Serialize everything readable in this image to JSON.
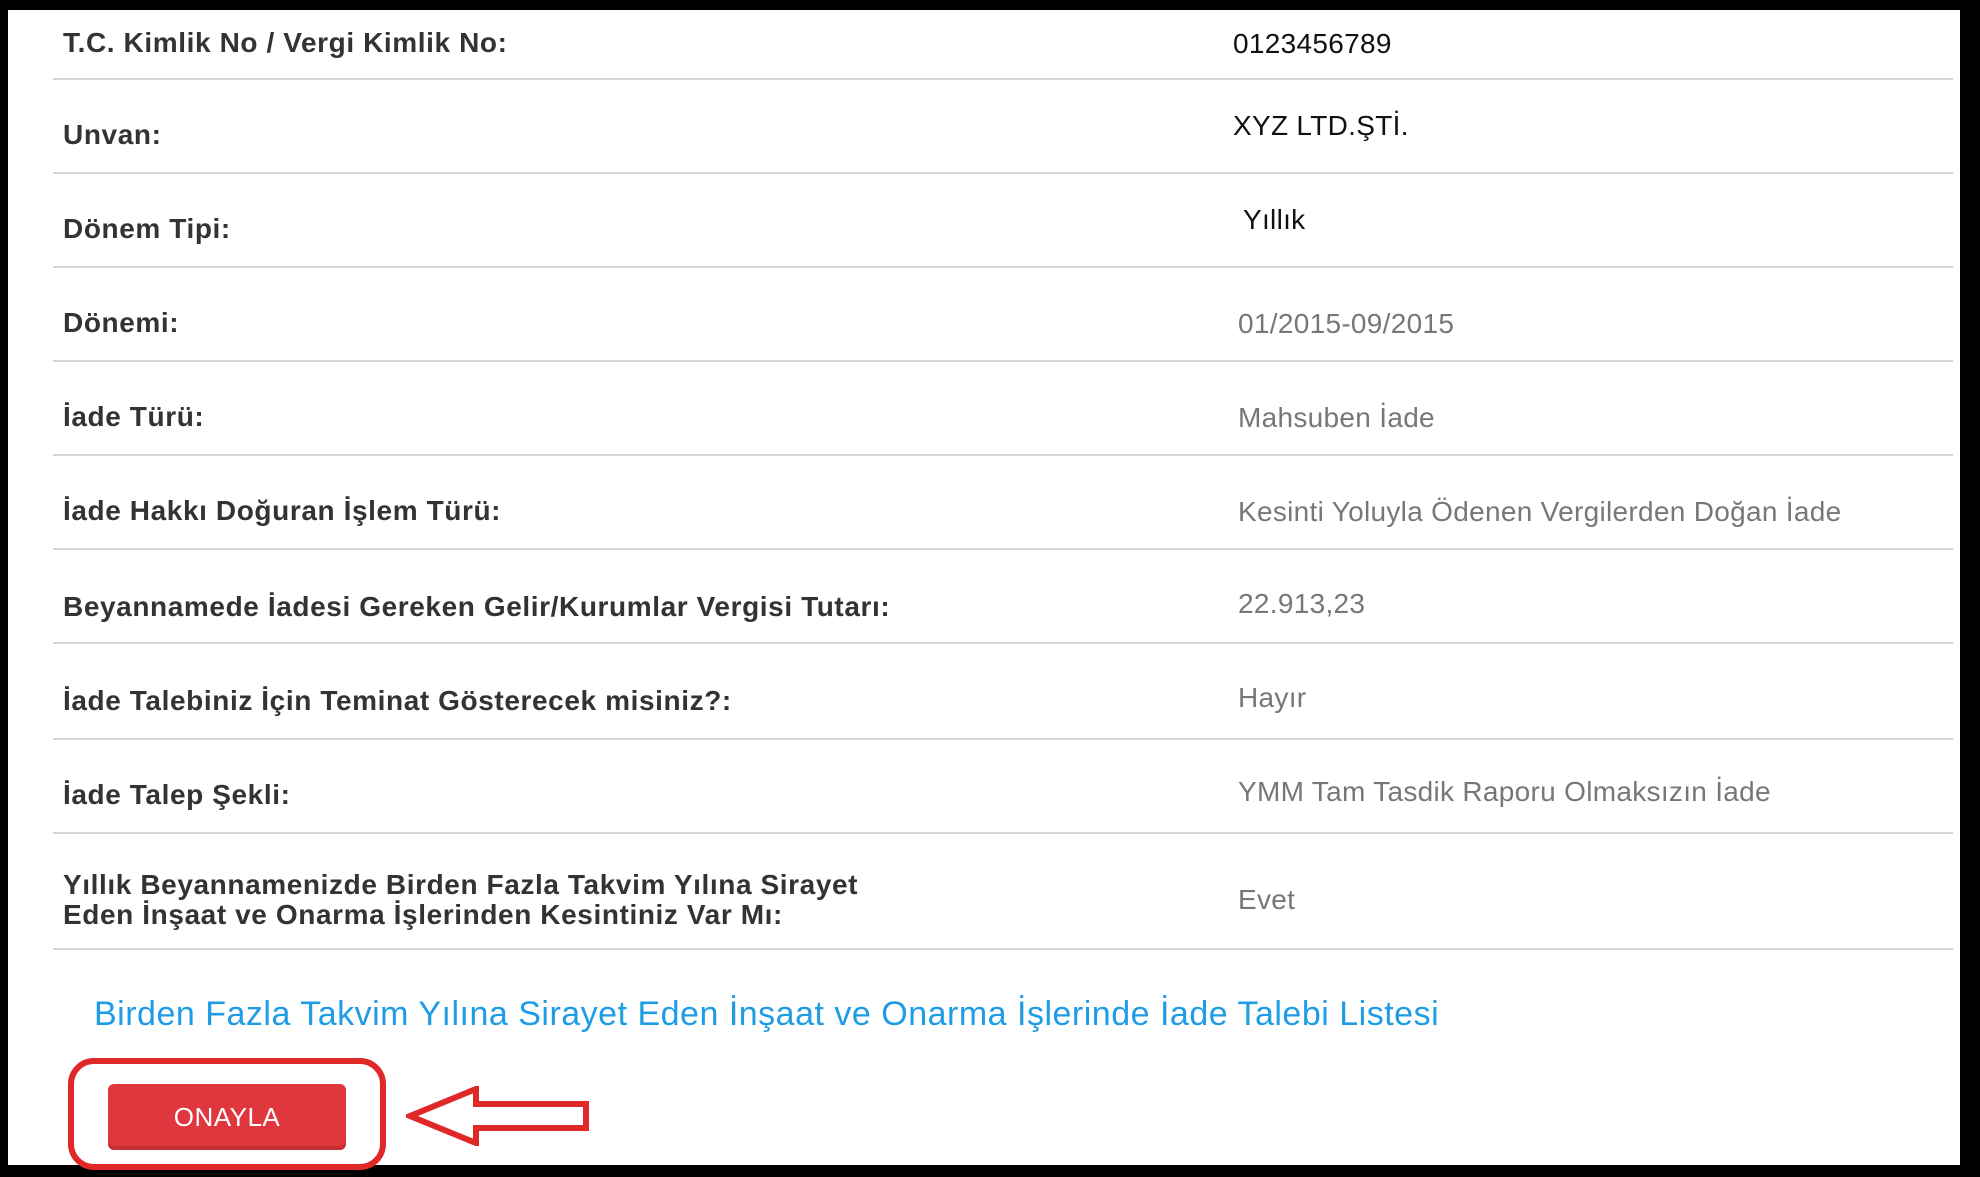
{
  "rows": [
    {
      "label": "T.C. Kimlik No / Vergi Kimlik No:",
      "value": "0123456789"
    },
    {
      "label": "Unvan:",
      "value": "XYZ LTD.ŞTİ."
    },
    {
      "label": "Dönem Tipi:",
      "value": "Yıllık"
    },
    {
      "label": "Dönemi:",
      "value": "01/2015-09/2015"
    },
    {
      "label": "İade Türü:",
      "value": "Mahsuben İade"
    },
    {
      "label": "İade Hakkı Doğuran İşlem Türü:",
      "value": "Kesinti Yoluyla Ödenen Vergilerden Doğan İade"
    },
    {
      "label": "Beyannamede İadesi Gereken Gelir/Kurumlar Vergisi Tutarı:",
      "value": "22.913,23"
    },
    {
      "label": "İade Talebiniz İçin Teminat Gösterecek misiniz?:",
      "value": "Hayır"
    },
    {
      "label": "İade Talep Şekli:",
      "value": "YMM Tam Tasdik Raporu Olmaksızın İade"
    },
    {
      "label_line1": "Yıllık Beyannamenizde Birden Fazla Takvim Yılına Sirayet",
      "label_line2": "Eden İnşaat ve Onarma İşlerinden Kesintiniz Var Mı:",
      "value": "Evet"
    }
  ],
  "list_link": "Birden Fazla Takvim Yılına Sirayet Eden İnşaat ve Onarma İşlerinde İade Talebi Listesi",
  "confirm_button": "ONAYLA",
  "colors": {
    "link": "#1e9ce6",
    "button": "#e0363d",
    "annotation": "#e02828"
  },
  "annotation_icons": [
    "highlight-circle",
    "arrow-left-icon"
  ]
}
